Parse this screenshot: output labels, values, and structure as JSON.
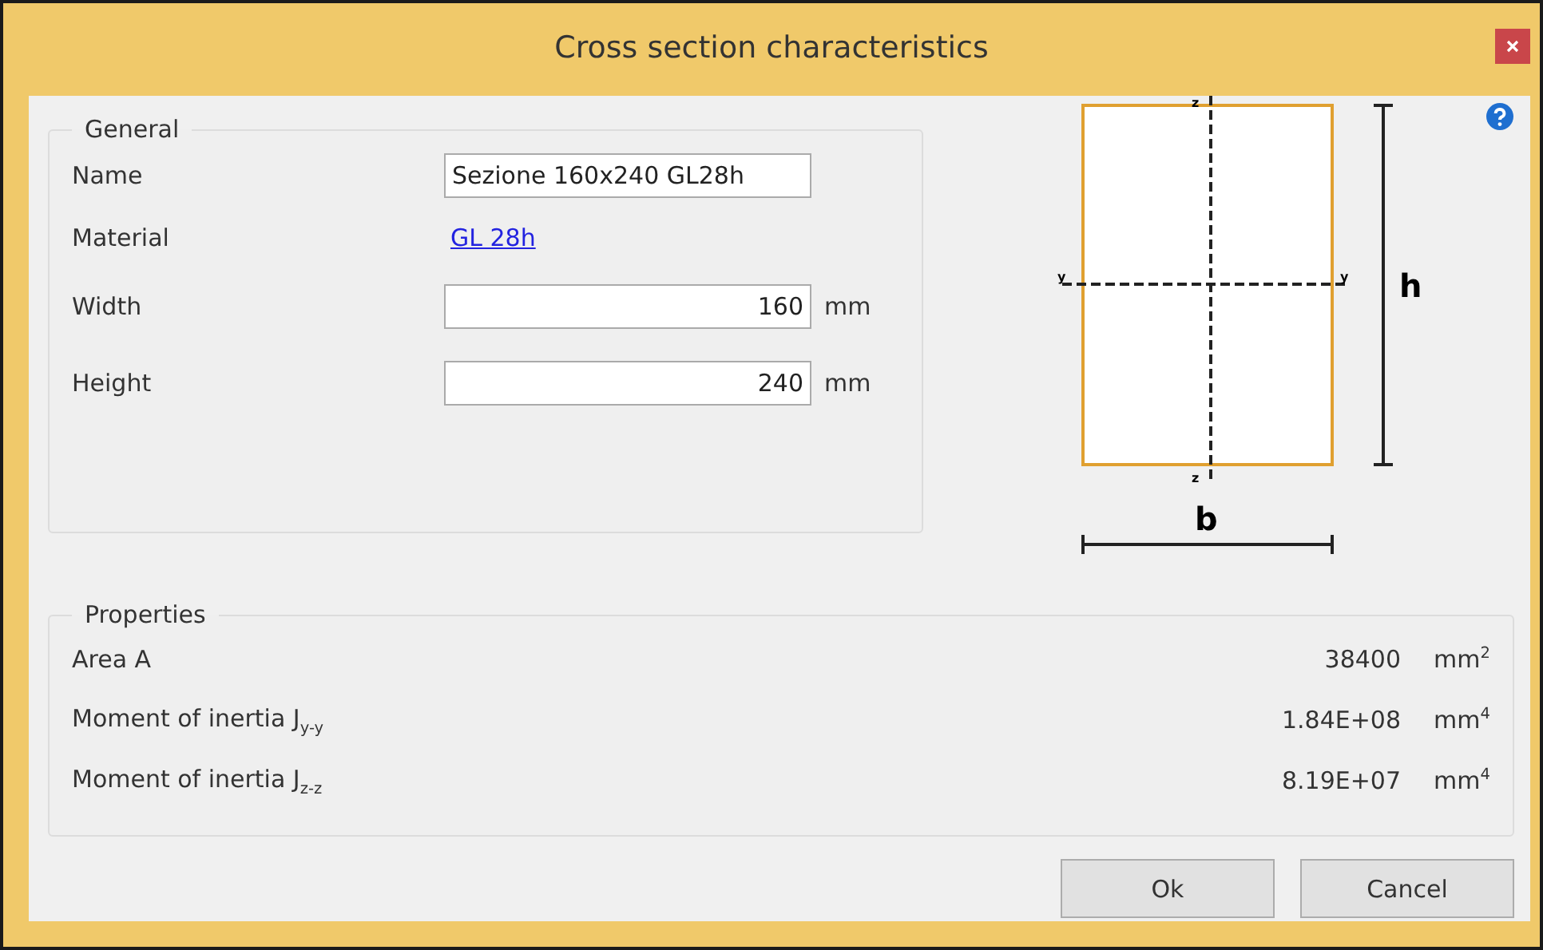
{
  "window": {
    "title": "Cross section characteristics"
  },
  "general": {
    "legend": "General",
    "fields": [
      {
        "kind": "text",
        "label": "Name",
        "value": "Sezione 160x240 GL28h"
      },
      {
        "kind": "link",
        "label": "Material",
        "value": "GL 28h"
      },
      {
        "kind": "number",
        "label": "Width",
        "value": "160",
        "unit": "mm"
      },
      {
        "kind": "number",
        "label": "Height",
        "value": "240",
        "unit": "mm"
      }
    ]
  },
  "diagram": {
    "top_axis_label": "z",
    "bottom_axis_label": "z",
    "left_axis_label": "y",
    "right_axis_label": "y",
    "height_label": "h",
    "width_label": "b"
  },
  "properties": {
    "legend": "Properties",
    "rows": [
      {
        "label": "Area A",
        "value": "38400",
        "unit": "mm$^{2}$"
      },
      {
        "label": "Moment of inertia J$_{y-y}$",
        "value": "1.84E+08",
        "unit": "mm$^{4}$"
      },
      {
        "label": "Moment of inertia J$_{z-z}$",
        "value": "8.19E+07",
        "unit": "mm$^{4}$"
      }
    ]
  },
  "buttons": [
    "Ok",
    "Cancel"
  ]
}
